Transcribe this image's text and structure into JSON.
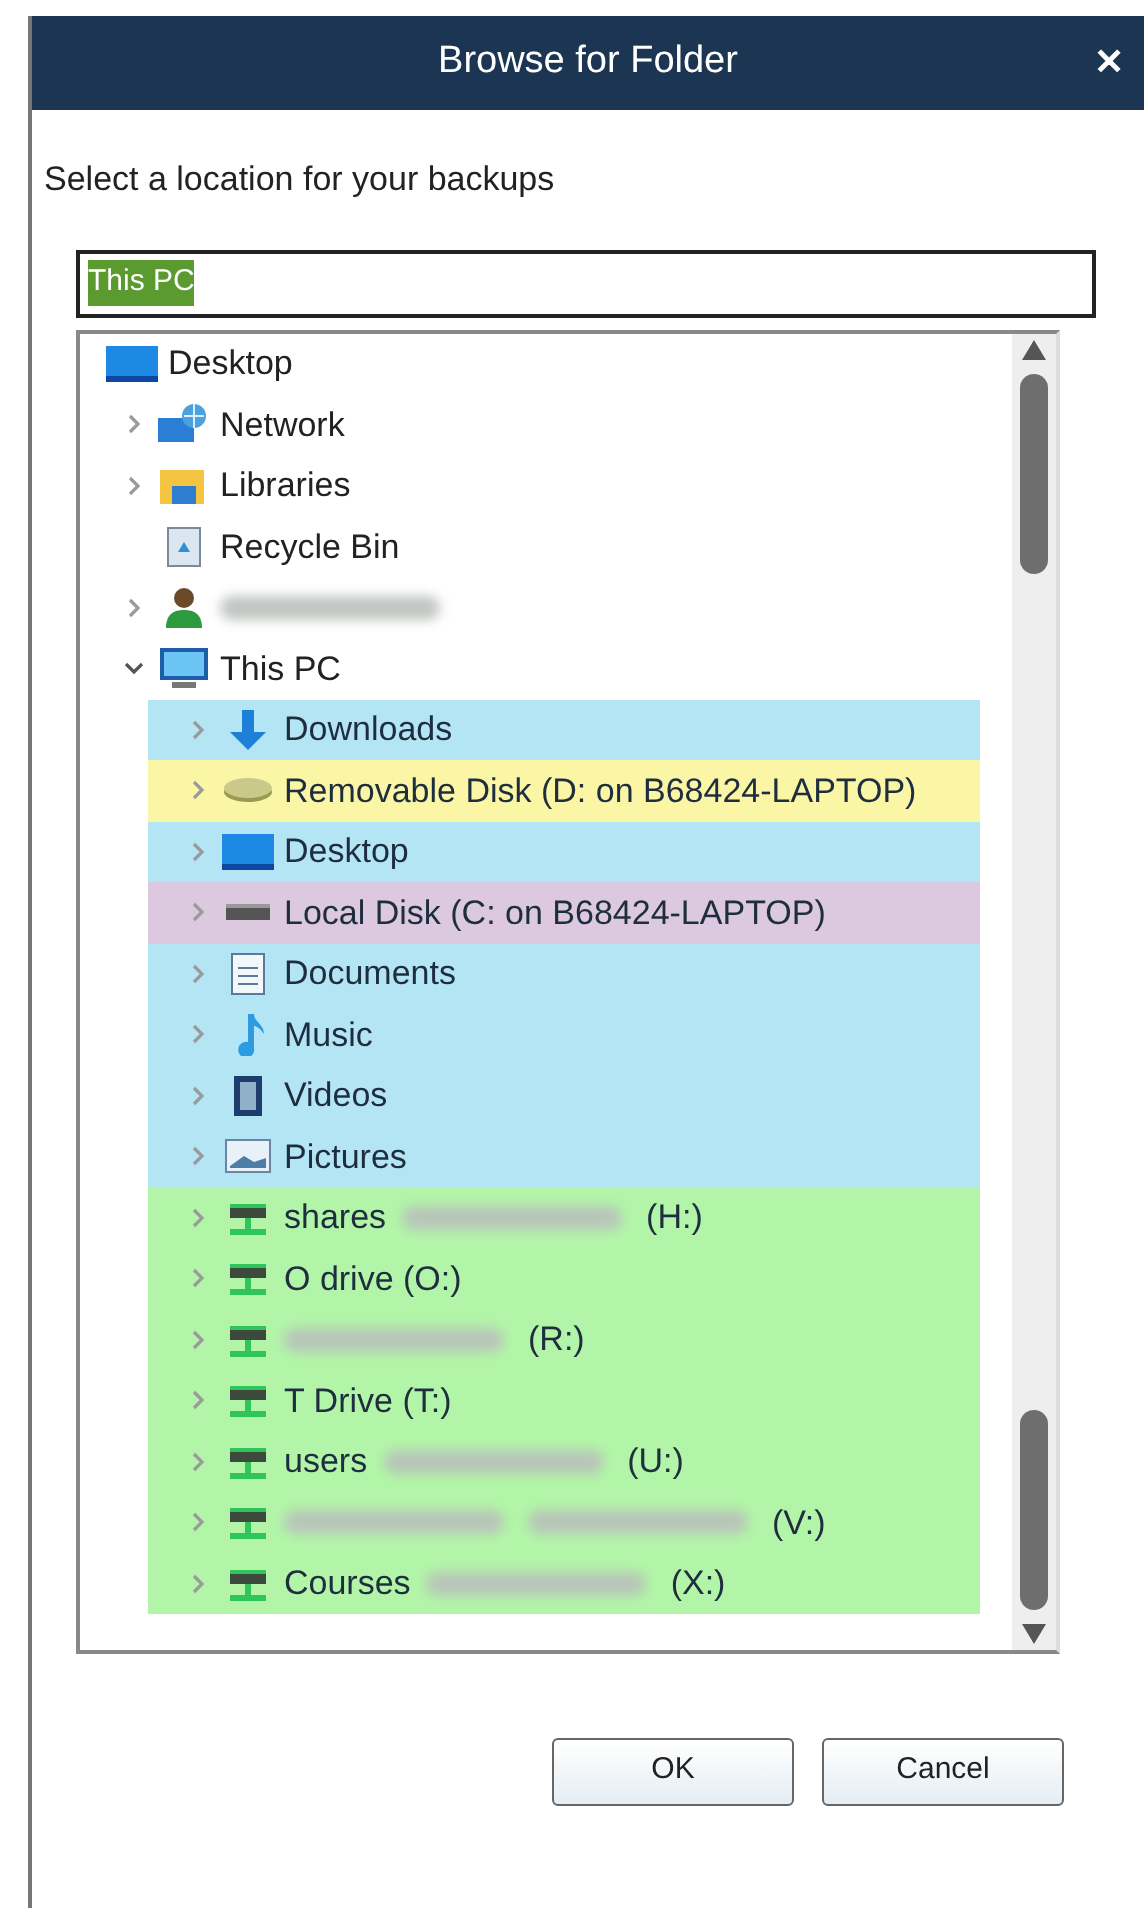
{
  "window": {
    "title": "Browse for Folder",
    "close": "✕"
  },
  "prompt": "Select a location for your backups",
  "path_field": {
    "value": "This PC",
    "value_selected": true
  },
  "tree": [
    {
      "kind": "monitor",
      "label": [
        {
          "kind": "text",
          "text": "Desktop"
        }
      ],
      "children": [
        {
          "kind": "network",
          "label": [
            {
              "kind": "text",
              "text": "Network"
            }
          ],
          "expanded": false
        },
        {
          "kind": "library",
          "label": [
            {
              "kind": "text",
              "text": "Libraries"
            }
          ],
          "expanded": false
        },
        {
          "kind": "recycle",
          "label": [
            {
              "kind": "text",
              "text": "Recycle Bin"
            }
          ]
        },
        {
          "kind": "user",
          "label": [
            {
              "kind": "blur"
            }
          ],
          "expanded": false
        },
        {
          "kind": "computer",
          "label": [
            {
              "kind": "text",
              "text": "This PC"
            }
          ],
          "expanded": true,
          "children": [
            {
              "kind": "download",
              "label": [
                {
                  "kind": "text",
                  "text": "Downloads"
                }
              ],
              "expanded": false,
              "color": "#b3e5f5"
            },
            {
              "kind": "removable",
              "label": [
                {
                  "kind": "text",
                  "text": "Removable Disk (D: on B68424-LAPTOP)"
                }
              ],
              "expanded": false,
              "color": "#fbf6a6"
            },
            {
              "kind": "monitor",
              "label": [
                {
                  "kind": "text",
                  "text": "Desktop"
                }
              ],
              "expanded": false,
              "color": "#b3e5f5"
            },
            {
              "kind": "disk",
              "label": [
                {
                  "kind": "text",
                  "text": "Local Disk (C: on B68424-LAPTOP)"
                }
              ],
              "expanded": false,
              "color": "#dcc8df"
            },
            {
              "kind": "document",
              "label": [
                {
                  "kind": "text",
                  "text": "Documents"
                }
              ],
              "expanded": false,
              "color": "#b3e5f5"
            },
            {
              "kind": "music",
              "label": [
                {
                  "kind": "text",
                  "text": "Music"
                }
              ],
              "expanded": false,
              "color": "#b3e5f5"
            },
            {
              "kind": "video",
              "label": [
                {
                  "kind": "text",
                  "text": "Videos"
                }
              ],
              "expanded": false,
              "color": "#b3e5f5"
            },
            {
              "kind": "picture",
              "label": [
                {
                  "kind": "text",
                  "text": "Pictures"
                }
              ],
              "expanded": false,
              "color": "#b3e5f5"
            },
            {
              "kind": "netdrive",
              "label": [
                {
                  "kind": "text",
                  "text": "shares"
                },
                {
                  "kind": "blur"
                },
                {
                  "kind": "text",
                  "text": "(H:)"
                }
              ],
              "expanded": false,
              "color": "#b2f5a8"
            },
            {
              "kind": "netdrive",
              "label": [
                {
                  "kind": "text",
                  "text": "O drive (O:)"
                }
              ],
              "expanded": false,
              "color": "#b2f5a8"
            },
            {
              "kind": "netdrive",
              "label": [
                {
                  "kind": "blur"
                },
                {
                  "kind": "text",
                  "text": "(R:)"
                }
              ],
              "expanded": false,
              "color": "#b2f5a8"
            },
            {
              "kind": "netdrive",
              "label": [
                {
                  "kind": "text",
                  "text": "T Drive (T:)"
                }
              ],
              "expanded": false,
              "color": "#b2f5a8"
            },
            {
              "kind": "netdrive",
              "label": [
                {
                  "kind": "text",
                  "text": "users"
                },
                {
                  "kind": "blur"
                },
                {
                  "kind": "text",
                  "text": "(U:)"
                }
              ],
              "expanded": false,
              "color": "#b2f5a8"
            },
            {
              "kind": "netdrive",
              "label": [
                {
                  "kind": "blur"
                },
                {
                  "kind": "blur"
                },
                {
                  "kind": "text",
                  "text": "(V:)"
                }
              ],
              "expanded": false,
              "color": "#b2f5a8"
            },
            {
              "kind": "netdrive",
              "label": [
                {
                  "kind": "text",
                  "text": "Courses"
                },
                {
                  "kind": "blur"
                },
                {
                  "kind": "text",
                  "text": "(X:)"
                }
              ],
              "expanded": false,
              "color": "#b2f5a8"
            }
          ]
        }
      ]
    }
  ],
  "buttons": [
    "OK",
    "Cancel"
  ]
}
